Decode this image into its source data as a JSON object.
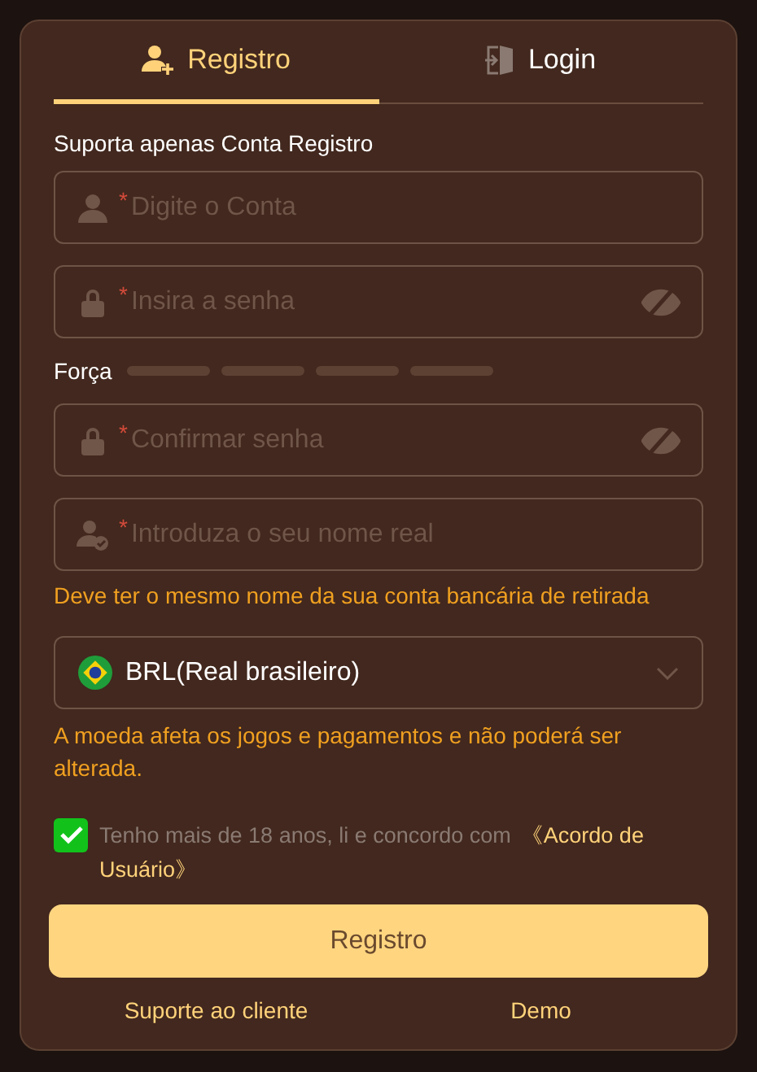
{
  "tabs": [
    {
      "label": "Registro",
      "kind": "register",
      "selected": true
    },
    {
      "label": "Login",
      "kind": "login",
      "selected": false
    }
  ],
  "notice": "Suporta apenas Conta Registro",
  "account_field": {
    "kind": "account",
    "required_mark": "*",
    "placeholder": "Digite o Conta"
  },
  "password_field": {
    "kind": "password",
    "required_mark": "*",
    "placeholder": "Insira a senha",
    "visible": false
  },
  "strength": {
    "label": "Força"
  },
  "confirm_field": {
    "kind": "password",
    "required_mark": "*",
    "placeholder": "Confirmar senha",
    "visible": false
  },
  "name_field": {
    "kind": "real-name",
    "required_mark": "*",
    "placeholder": "Introduza o seu nome real"
  },
  "name_hint": "Deve ter o mesmo nome da sua conta bancária de retirada",
  "currency_select": {
    "value": "BRL(Real brasileiro)"
  },
  "currency_warning": "A moeda afeta os jogos e pagamentos e não poderá ser alterada.",
  "agreement": {
    "checked": true,
    "text": "Tenho mais de 18 anos, li e concordo com",
    "link_lines": [
      "《Acordo de",
      "Usuário》"
    ]
  },
  "submit_button": "Registro",
  "footer_links": [
    "Suporte ao cliente",
    "Demo"
  ]
}
